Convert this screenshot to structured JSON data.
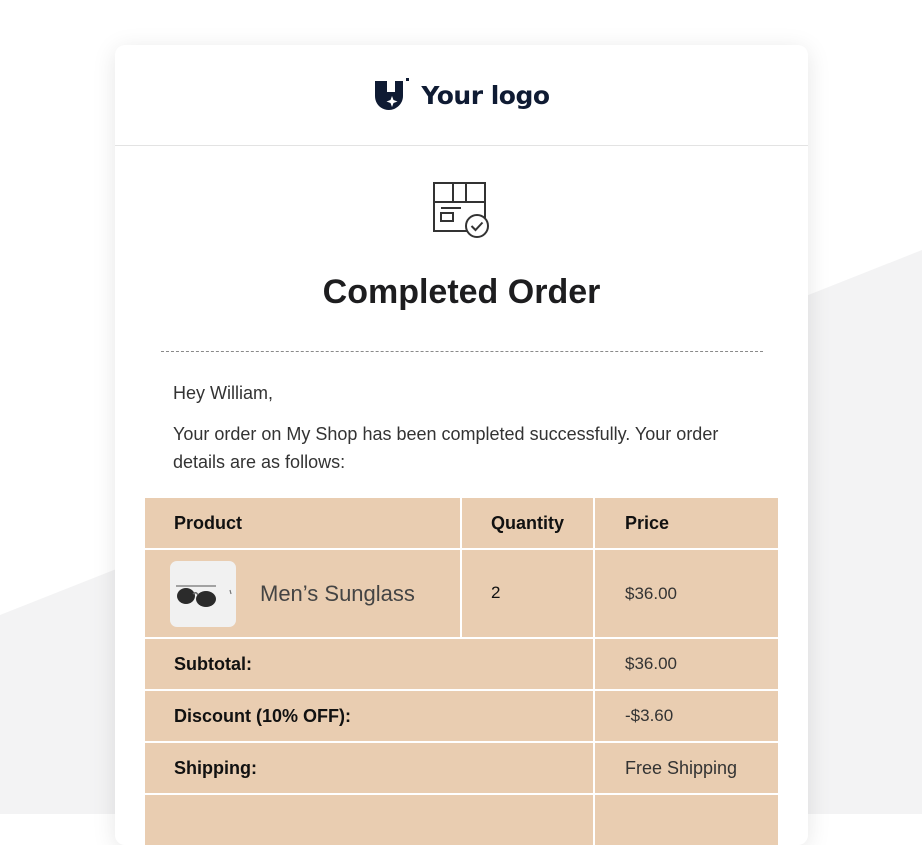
{
  "header": {
    "logo_text": "Your logo",
    "logo_icon": "shield-star-icon"
  },
  "hero": {
    "icon": "package-check-icon",
    "title": "Completed Order"
  },
  "greeting": "Hey William,",
  "message": "Your order on My Shop has been completed successfully. Your order details are as follows:",
  "table": {
    "columns": [
      "Product",
      "Quantity",
      "Price"
    ],
    "items": [
      {
        "name": "Men’s Sunglass",
        "quantity": "2",
        "price": "$36.00",
        "image_icon": "sunglasses-icon"
      }
    ],
    "summary": [
      {
        "label": "Subtotal:",
        "value": "$36.00"
      },
      {
        "label": "Discount (10% OFF):",
        "value": "-$3.60"
      },
      {
        "label": "Shipping:",
        "value": "Free Shipping"
      }
    ]
  },
  "colors": {
    "table_bg": "#e9cdb1",
    "brand": "#0f1b33",
    "page_shape": "#f3f3f4"
  }
}
